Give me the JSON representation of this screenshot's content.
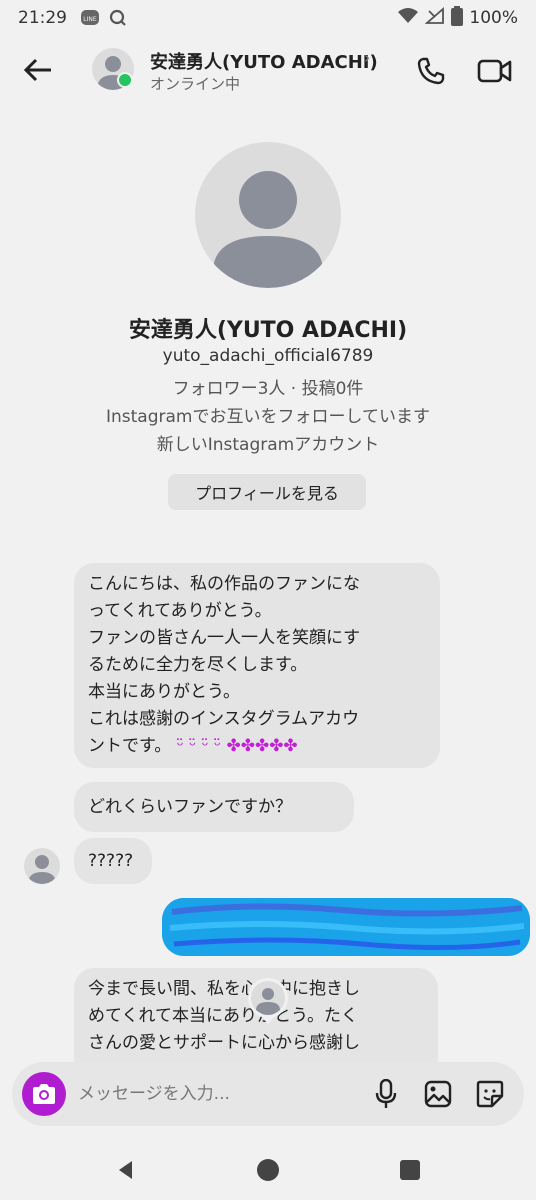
{
  "status_bar": {
    "time": "21:29",
    "battery": "100%",
    "icons": [
      "line-icon",
      "search-notification-icon",
      "wifi-icon",
      "signal-icon",
      "battery-icon"
    ]
  },
  "header": {
    "title": "安達勇人(YUTO ADACHI)",
    "subtitle": "オンライン中",
    "chevron": "›",
    "online_color": "#22c55e"
  },
  "profile": {
    "name": "安達勇人(YUTO ADACHI)",
    "username": "yuto_adachi_official6789",
    "stats": "フォロワー3人 · 投稿0件",
    "mutual": "Instagramでお互いをフォローしています",
    "new_account": "新しいInstagramアカウント",
    "view_profile_button": "プロフィールを見る"
  },
  "messages": [
    {
      "direction": "received",
      "lines": [
        "こんにちは、私の作品のファンにな",
        "ってくれてありがとう。",
        "ファンの皆さん一人一人を笑顔にす",
        "るために全力を尽くします。",
        "本当にありがとう。",
        "これは感謝のインスタグラムアカウ",
        "ントです。"
      ],
      "emoji_tail": "ᵕ̈ ᵕ̈ ᵕ̈ ᵕ̈ ✤✤✤✤✤"
    },
    {
      "direction": "received",
      "text": "どれくらいファンですか？"
    },
    {
      "direction": "received",
      "text": "?????"
    },
    {
      "direction": "sent",
      "text": "",
      "redacted": true,
      "redaction_color": "#1aa3e8"
    },
    {
      "direction": "received",
      "lines": [
        "今まで長い間、私を心の中に抱きし",
        "めてくれて本当にありがとう。たく",
        "さんの愛とサポートに心から感謝し"
      ]
    }
  ],
  "composer": {
    "placeholder": "メッセージを入力...",
    "accent_color": "#b01ccf"
  },
  "nav_bar": {
    "icons": [
      "back-icon",
      "home-icon",
      "recents-icon"
    ]
  }
}
